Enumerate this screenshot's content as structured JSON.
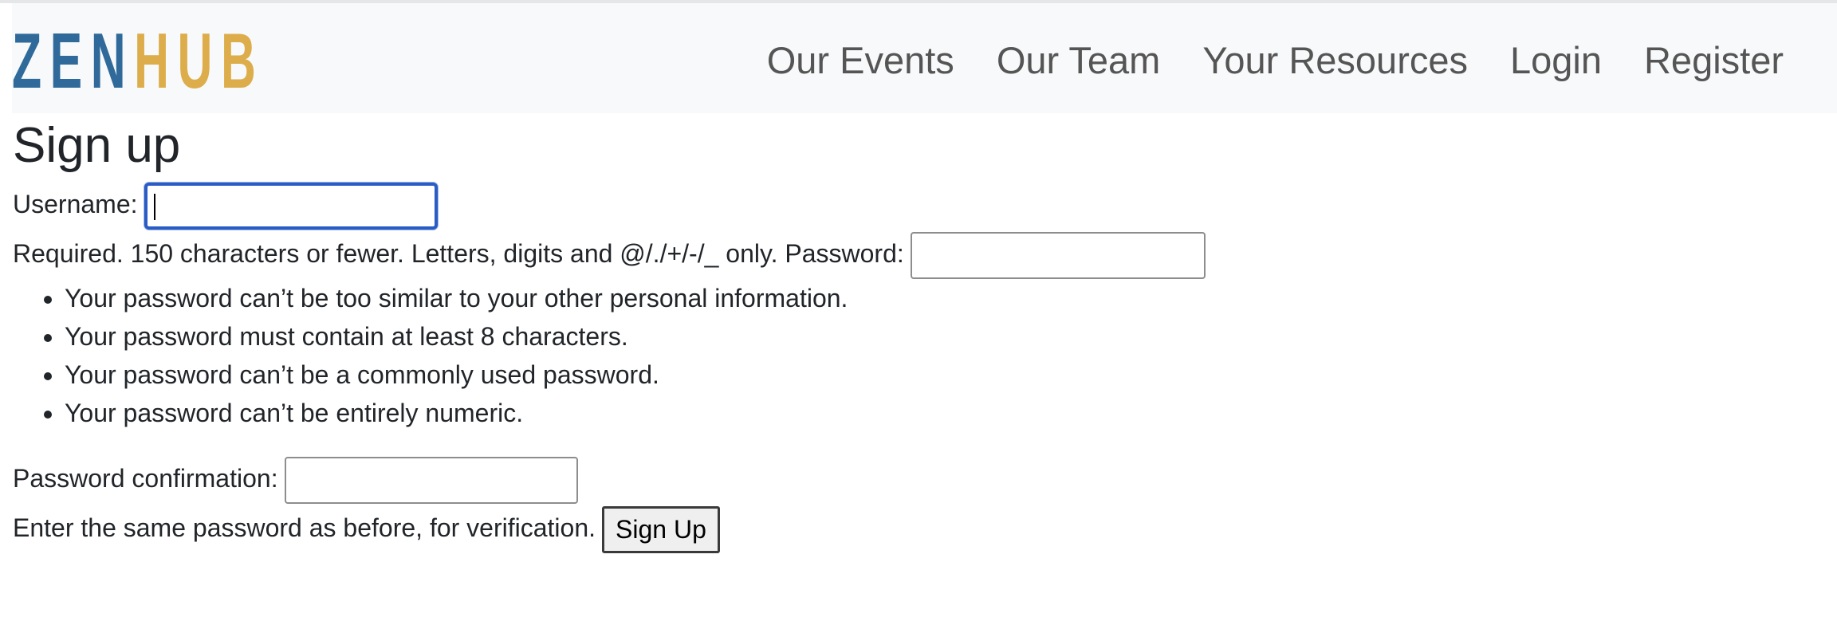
{
  "brand": {
    "part1": "ZEN",
    "part2": "HUB"
  },
  "nav": {
    "items": [
      {
        "label": "Our Events"
      },
      {
        "label": "Our Team"
      },
      {
        "label": "Your Resources"
      },
      {
        "label": "Login"
      },
      {
        "label": "Register"
      }
    ]
  },
  "page": {
    "title": "Sign up"
  },
  "form": {
    "username_label": "Username:",
    "username_value": "",
    "username_help": "Required. 150 characters or fewer. Letters, digits and @/./+/-/_ only.",
    "password_label": "Password:",
    "password_value": "",
    "password_rules": [
      "Your password can’t be too similar to your other personal information.",
      "Your password must contain at least 8 characters.",
      "Your password can’t be a commonly used password.",
      "Your password can’t be entirely numeric."
    ],
    "confirm_label": "Password confirmation:",
    "confirm_value": "",
    "confirm_help": "Enter the same password as before, for verification.",
    "submit_label": "Sign Up"
  },
  "colors": {
    "brand_blue": "#2f6a9a",
    "brand_gold": "#dcad4a",
    "navbar_bg": "#f8f9fa",
    "focus_ring": "#2a5cc4"
  }
}
